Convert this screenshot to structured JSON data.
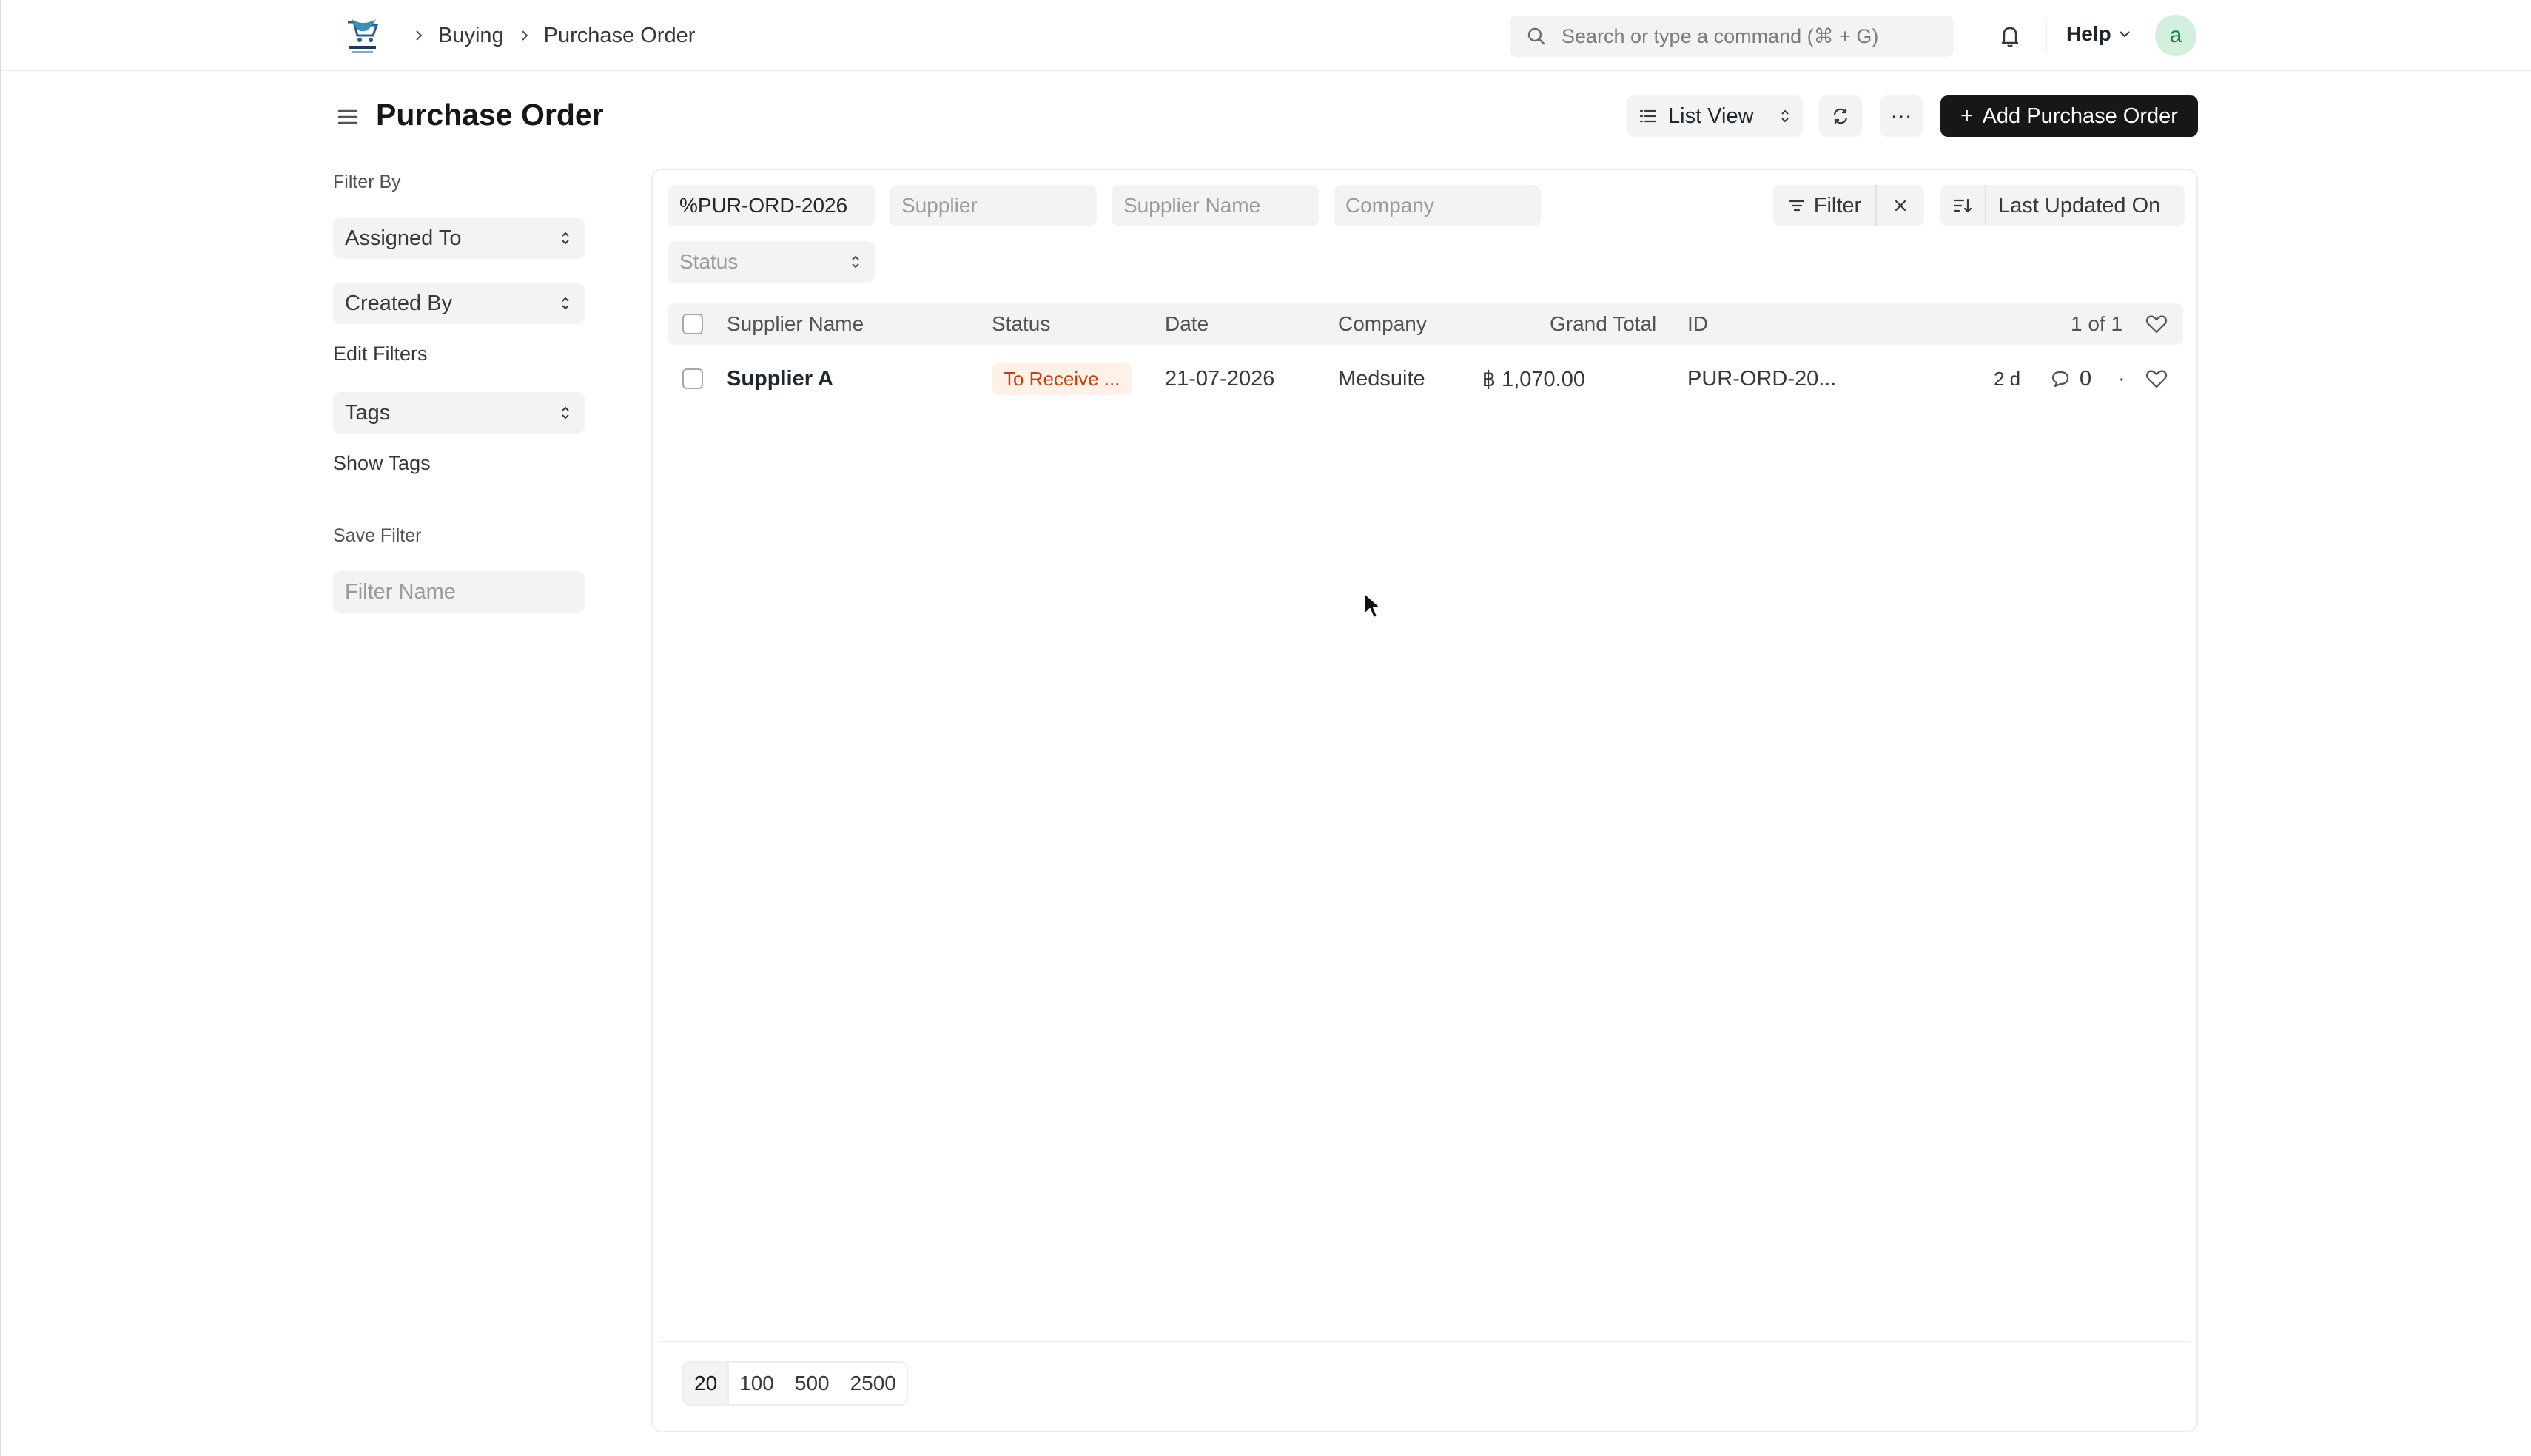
{
  "breadcrumbs": [
    "Buying",
    "Purchase Order"
  ],
  "search": {
    "placeholder": "Search or type a command (⌘ + G)"
  },
  "navbar": {
    "help_label": "Help",
    "avatar_letter": "a"
  },
  "page": {
    "title": "Purchase Order"
  },
  "toolbar": {
    "view_label": "List View",
    "add_label": "Add Purchase Order",
    "more_label": "···"
  },
  "sidebar": {
    "filter_by_label": "Filter By",
    "assigned_to": "Assigned To",
    "created_by": "Created By",
    "edit_filters": "Edit Filters",
    "tags": "Tags",
    "show_tags": "Show Tags",
    "save_filter_label": "Save Filter",
    "filter_name_placeholder": "Filter Name"
  },
  "filters": {
    "id_value": "%PUR-ORD-2026",
    "supplier_placeholder": "Supplier",
    "supplier_name_placeholder": "Supplier Name",
    "company_placeholder": "Company",
    "status_placeholder": "Status",
    "filter_label": "Filter",
    "sort_label": "Last Updated On"
  },
  "table": {
    "columns": [
      "Supplier Name",
      "Status",
      "Date",
      "Company",
      "Grand Total",
      "ID"
    ],
    "count_label": "1 of 1",
    "rows": [
      {
        "supplier_name": "Supplier A",
        "status": "To Receive ...",
        "date": "21-07-2026",
        "company": "Medsuite",
        "grand_total": "฿ 1,070.00",
        "id": "PUR-ORD-20...",
        "modified": "2 d",
        "comments": "0",
        "dot": "·"
      }
    ]
  },
  "pagination": {
    "page_sizes": [
      "20",
      "100",
      "500",
      "2500"
    ],
    "selected": "20"
  },
  "colors": {
    "primary_button": "#171717",
    "status_badge_bg": "#fff1e7",
    "status_badge_text": "#c2410c",
    "avatar_bg": "#d2f0dd"
  }
}
